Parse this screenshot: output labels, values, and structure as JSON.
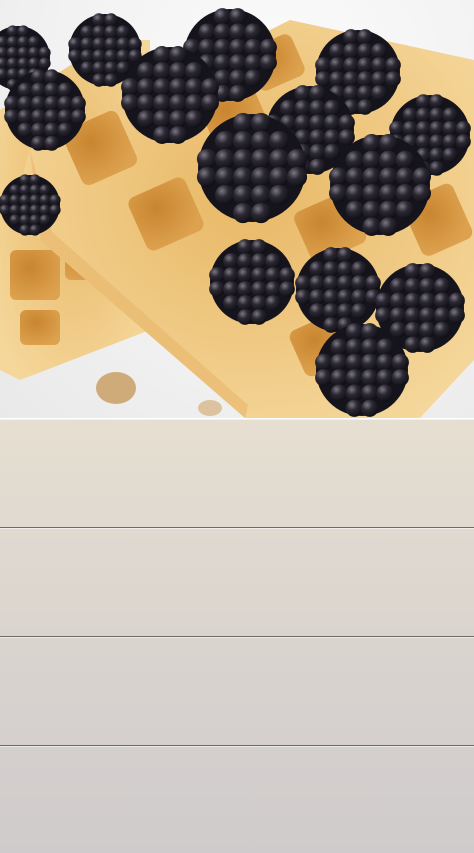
{
  "hero": {
    "image": "waffles-with-blackberries-photo"
  },
  "list": {
    "rows": [
      {
        "label": ""
      },
      {
        "label": ""
      },
      {
        "label": ""
      },
      {
        "label": ""
      }
    ]
  },
  "colors": {
    "waffle_light": "#f0cf8c",
    "waffle_dark": "#c98b35",
    "berry": "#23212a",
    "berry_highlight": "#6b6874",
    "row_divider": "#6f6a62"
  }
}
